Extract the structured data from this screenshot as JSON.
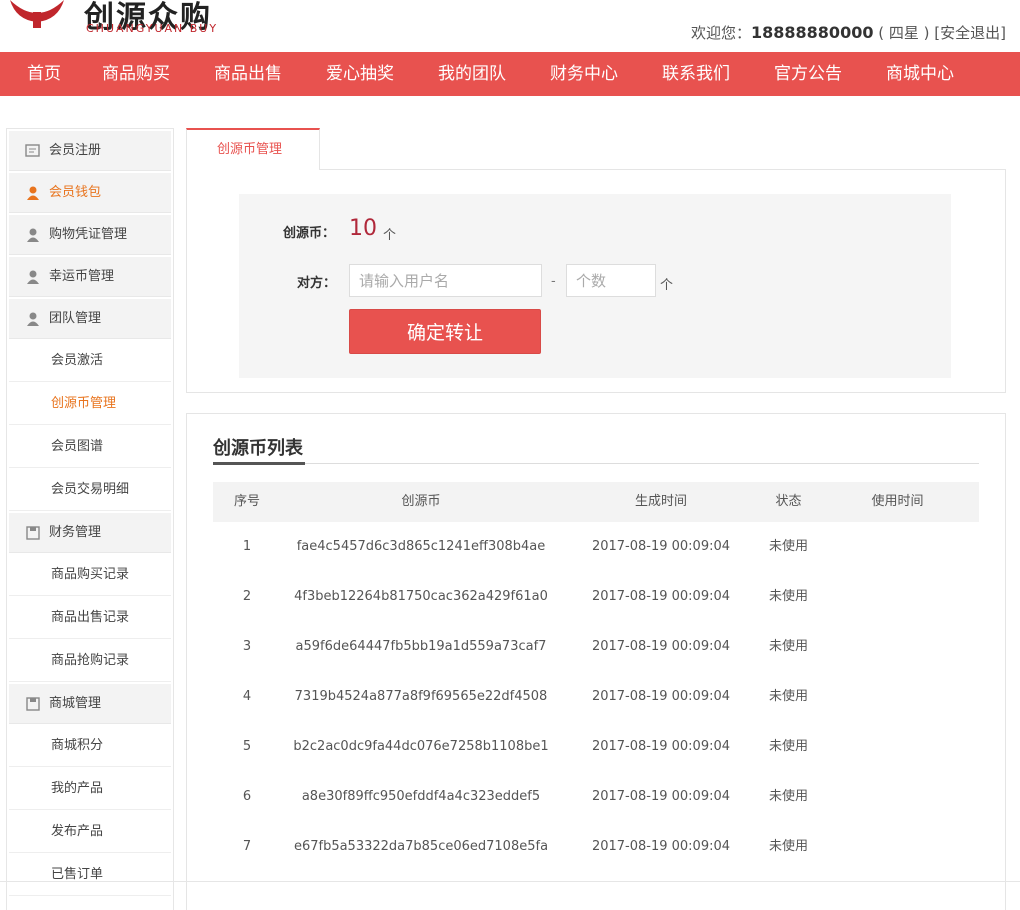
{
  "header": {
    "logo_cn": "创源众购",
    "logo_en": "CHUANGYUAN BUY",
    "welcome_prefix": "欢迎您：",
    "phone": "18888880000",
    "level": "( 四星 )",
    "logout": "[安全退出]"
  },
  "nav": [
    "首页",
    "商品购买",
    "商品出售",
    "爱心抽奖",
    "我的团队",
    "财务中心",
    "联系我们",
    "官方公告",
    "商城中心"
  ],
  "sidebar": {
    "g1": "会员注册",
    "g2": "会员钱包",
    "g3": "购物凭证管理",
    "g4": "幸运币管理",
    "g5": "团队管理",
    "s5": [
      "会员激活",
      "创源币管理",
      "会员图谱",
      "会员交易明细"
    ],
    "g6": "财务管理",
    "s6": [
      "商品购买记录",
      "商品出售记录",
      "商品抢购记录"
    ],
    "g7": "商城管理",
    "s7": [
      "商城积分",
      "我的产品",
      "发布产品",
      "已售订单"
    ]
  },
  "form": {
    "tab": "创源币管理",
    "coin_label": "创源币：",
    "coin_value": "10",
    "coin_unit": "个",
    "target_label": "对方：",
    "user_placeholder": "请输入用户名",
    "dash": "-",
    "count_placeholder": "个数",
    "count_unit": "个",
    "submit": "确定转让"
  },
  "list": {
    "title": "创源币列表",
    "headers": [
      "序号",
      "创源币",
      "生成时间",
      "状态",
      "使用时间"
    ],
    "rows": [
      {
        "no": "1",
        "code": "fae4c5457d6c3d865c1241eff308b4ae",
        "time": "2017-08-19 00:09:04",
        "status": "未使用",
        "used": ""
      },
      {
        "no": "2",
        "code": "4f3beb12264b81750cac362a429f61a0",
        "time": "2017-08-19 00:09:04",
        "status": "未使用",
        "used": ""
      },
      {
        "no": "3",
        "code": "a59f6de64447fb5bb19a1d559a73caf7",
        "time": "2017-08-19 00:09:04",
        "status": "未使用",
        "used": ""
      },
      {
        "no": "4",
        "code": "7319b4524a877a8f9f69565e22df4508",
        "time": "2017-08-19 00:09:04",
        "status": "未使用",
        "used": ""
      },
      {
        "no": "5",
        "code": "b2c2ac0dc9fa44dc076e7258b1108be1",
        "time": "2017-08-19 00:09:04",
        "status": "未使用",
        "used": ""
      },
      {
        "no": "6",
        "code": "a8e30f89ffc950efddf4a4c323eddef5",
        "time": "2017-08-19 00:09:04",
        "status": "未使用",
        "used": ""
      },
      {
        "no": "7",
        "code": "e67fb5a53322da7b85ce06ed7108e5fa",
        "time": "2017-08-19 00:09:04",
        "status": "未使用",
        "used": ""
      }
    ]
  },
  "colors": {
    "brand": "#e8524f",
    "active": "#e8741e",
    "coin": "#b0283a"
  },
  "icons": [
    "logo-icon",
    "register-icon",
    "user-icon",
    "save-icon"
  ]
}
